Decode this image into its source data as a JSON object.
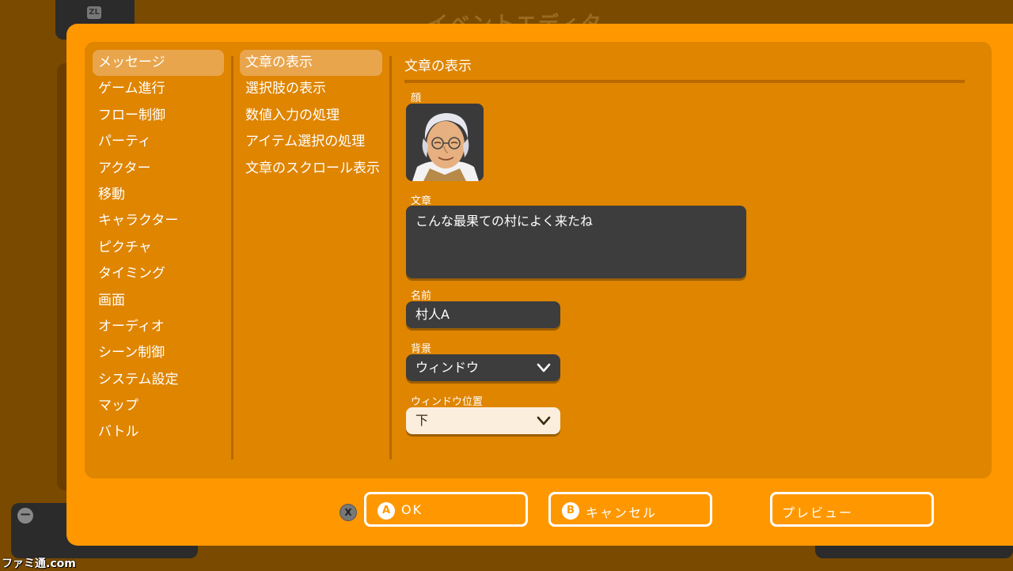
{
  "background": {
    "zl_label": "ZL",
    "title": "イベントエディタ",
    "minus_label": "−"
  },
  "watermark": "ファミ通.com",
  "dialog": {
    "categories": [
      {
        "label": "メッセージ",
        "selected": true
      },
      {
        "label": "ゲーム進行"
      },
      {
        "label": "フロー制御"
      },
      {
        "label": "パーティ"
      },
      {
        "label": "アクター"
      },
      {
        "label": "移動"
      },
      {
        "label": "キャラクター"
      },
      {
        "label": "ピクチャ"
      },
      {
        "label": "タイミング"
      },
      {
        "label": "画面"
      },
      {
        "label": "オーディオ"
      },
      {
        "label": "シーン制御"
      },
      {
        "label": "システム設定"
      },
      {
        "label": "マップ"
      },
      {
        "label": "バトル"
      }
    ],
    "commands": [
      {
        "label": "文章の表示",
        "selected": true
      },
      {
        "label": "選択肢の表示"
      },
      {
        "label": "数値入力の処理"
      },
      {
        "label": "アイテム選択の処理"
      },
      {
        "label": "文章のスクロール表示"
      }
    ],
    "form": {
      "title": "文章の表示",
      "face_label": "顔",
      "text_label": "文章",
      "text_value": "こんな最果ての村によく来たね",
      "name_label": "名前",
      "name_value": "村人A",
      "background_label": "背景",
      "background_value": "ウィンドウ",
      "position_label": "ウィンドウ位置",
      "position_value": "下"
    },
    "buttons": {
      "x_badge": "X",
      "ok_key": "A",
      "ok_label": "OK",
      "cancel_key": "B",
      "cancel_label": "キャンセル",
      "preview_label": "プレビュー"
    }
  },
  "colors": {
    "dialog_bg": "#ff9800",
    "panel_bg": "#df8500",
    "selected_item": "#e9a54c",
    "field_dark": "#3d3d3d",
    "field_light": "#fbeedd"
  }
}
